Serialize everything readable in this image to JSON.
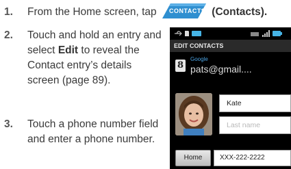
{
  "steps": [
    {
      "number": "1.",
      "before": "From the Home screen, tap",
      "button_label": "CONTACTS",
      "after": "(Contacts)."
    },
    {
      "number": "2.",
      "before": "Touch and hold an entry and select ",
      "bold": "Edit",
      "after": " to reveal the Contact entry’s details screen (page 89)."
    },
    {
      "number": "3.",
      "text": "Touch a phone number field and enter a phone number."
    }
  ],
  "phone": {
    "title": "EDIT CONTACTS",
    "account_badge": "8",
    "account_type": "Google",
    "account_email": "pats@gmail....",
    "first_name": "Kate",
    "last_name_placeholder": "Last name",
    "phone_type": "Home",
    "phone_number": "XXX-222-2222"
  },
  "colors": {
    "contacts_button": "#2f8fd0",
    "account_type_text": "#4ba3e3",
    "status_icon": "#46b4e6"
  }
}
